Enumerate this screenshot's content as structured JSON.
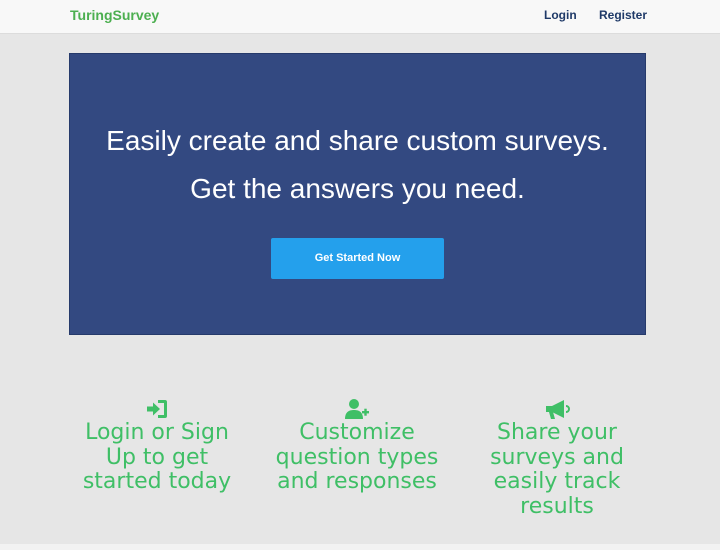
{
  "navbar": {
    "brand": "TuringSurvey",
    "links": [
      {
        "label": "Login"
      },
      {
        "label": "Register"
      }
    ]
  },
  "hero": {
    "line1": "Easily create and share custom surveys.",
    "line2": "Get the answers you need.",
    "cta_label": "Get Started Now"
  },
  "features": [
    {
      "icon": "sign-in-icon",
      "text": "Login or Sign Up to get started today"
    },
    {
      "icon": "user-plus-icon",
      "text": "Customize question types and responses"
    },
    {
      "icon": "bullhorn-icon",
      "text": "Share your surveys and easily track results"
    }
  ],
  "colors": {
    "brand_green": "#4caf50",
    "hero_bg": "#334981",
    "cta_blue": "#24a0ec",
    "feature_green": "#3fbf66",
    "nav_link": "#1f3a68",
    "page_bg": "#e6e6e6"
  }
}
